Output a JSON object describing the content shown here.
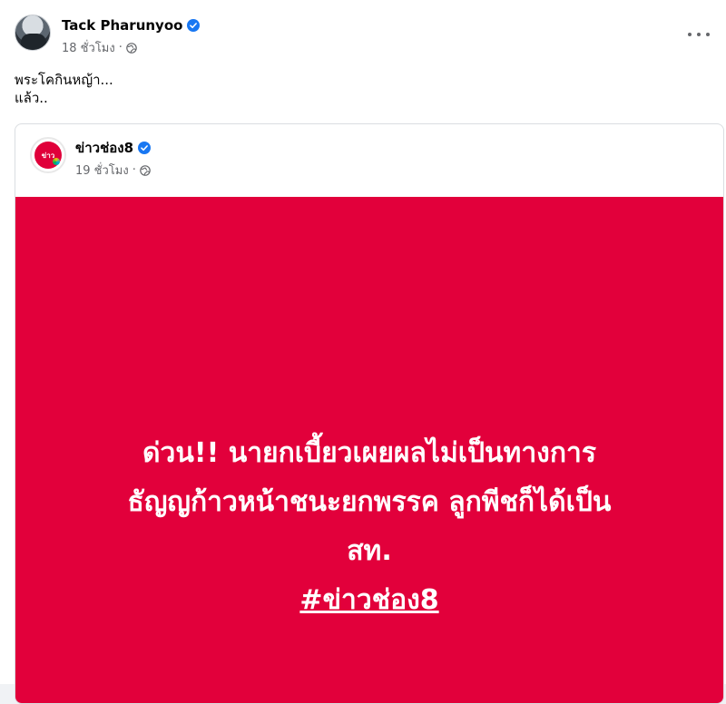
{
  "post": {
    "author": "Tack Pharunyoo",
    "time": "18 ชั่วโมง",
    "separator": "·",
    "text_lines": [
      "พระโคกินหญ้า...",
      "แล้ว.."
    ]
  },
  "shared_post": {
    "author": "ข่าวช่อง8",
    "logo_text": "ข่าว",
    "time": "19 ชั่วโมง",
    "separator": "·",
    "headline_lines": [
      "ด่วน!! นายกเบี้ยวเผยผลไม่เป็นทางการ",
      "ธัญญก้าวหน้าชนะยกพรรค ลูกพีชก็ได้เป็น",
      "สท."
    ],
    "hashtag": "#ข่าวช่อง8"
  },
  "icons": {
    "verified": "verified-badge-icon",
    "globe": "globe-icon",
    "more": "more-options-icon"
  },
  "colors": {
    "card_background": "#e2003b",
    "verified": "#1877f2",
    "meta_text": "#65676b"
  }
}
